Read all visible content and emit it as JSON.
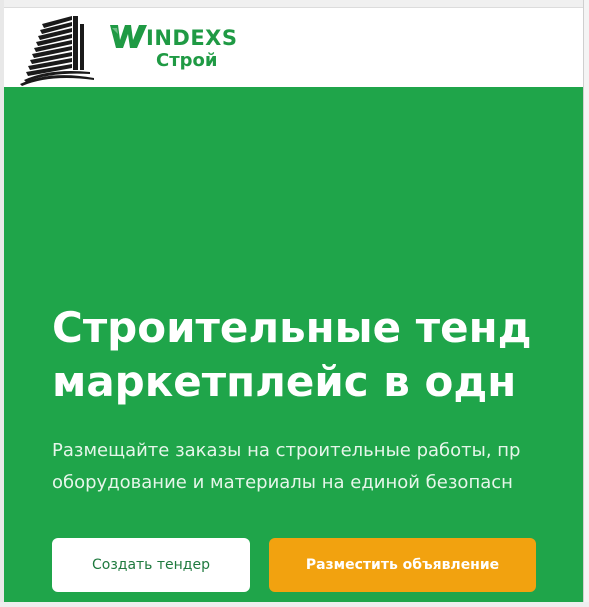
{
  "header": {
    "logo": {
      "brand_rest": "INDEXS",
      "brand_sub": "Строй",
      "icon": "office-building-icon",
      "brand_color": "#1f9a44"
    }
  },
  "hero": {
    "background_color": "#1fa54a",
    "title_lines": [
      "Строительные тенд",
      "маркетплейс в одн"
    ],
    "subtitle_lines": [
      "Размещайте заказы на строительные работы, пр",
      "оборудование и материалы на единой безопасн"
    ],
    "buttons": {
      "create_tender": "Создать тендер",
      "post_ad": "Разместить объявление"
    },
    "accent_color": "#f2a20f"
  }
}
